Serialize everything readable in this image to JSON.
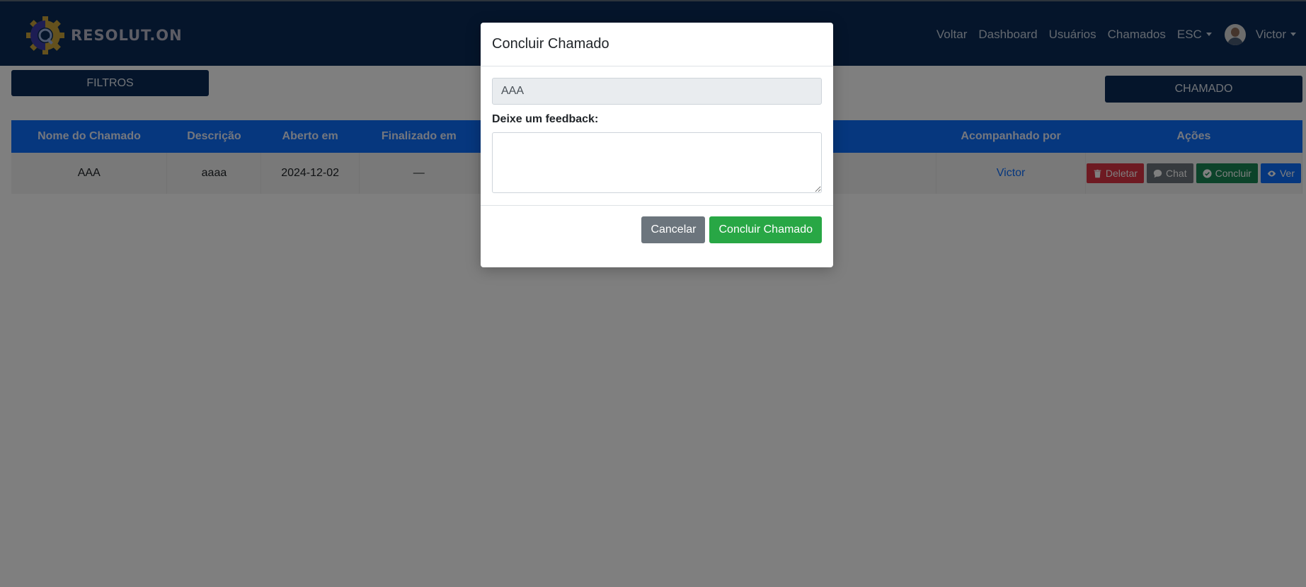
{
  "navbar": {
    "logo_text": "RESOLUT.ON",
    "links": [
      "Voltar",
      "Dashboard",
      "Usuários",
      "Chamados"
    ],
    "language": "ESC",
    "user": "Victor"
  },
  "page": {
    "filters_button": "FILTROS",
    "new_call_button": "CHAMADO",
    "table": {
      "headers": [
        "Nome do Chamado",
        "Descrição",
        "Aberto em",
        "Finalizado em",
        "Acompanhado por",
        "Ações"
      ],
      "rows": [
        {
          "name": "AAA",
          "description": "aaaa",
          "opened": "2024-12-02",
          "finished": "—",
          "followed_by": "Victor"
        }
      ],
      "actions": {
        "delete": "Deletar",
        "chat": "Chat",
        "conclude": "Concluir",
        "view": "Ver"
      }
    }
  },
  "modal": {
    "title": "Concluir Chamado",
    "call_name_value": "AAA",
    "feedback_label": "Deixe um feedback:",
    "feedback_value": "",
    "cancel_button": "Cancelar",
    "confirm_button": "Concluir Chamado"
  },
  "colors": {
    "navbar_bg": "#0a2a57",
    "table_header_bg": "#0d6efd",
    "delete": "#dc3545",
    "chat": "#6c757d",
    "conclude": "#198754",
    "view": "#0d6efd",
    "confirm": "#28a745"
  }
}
